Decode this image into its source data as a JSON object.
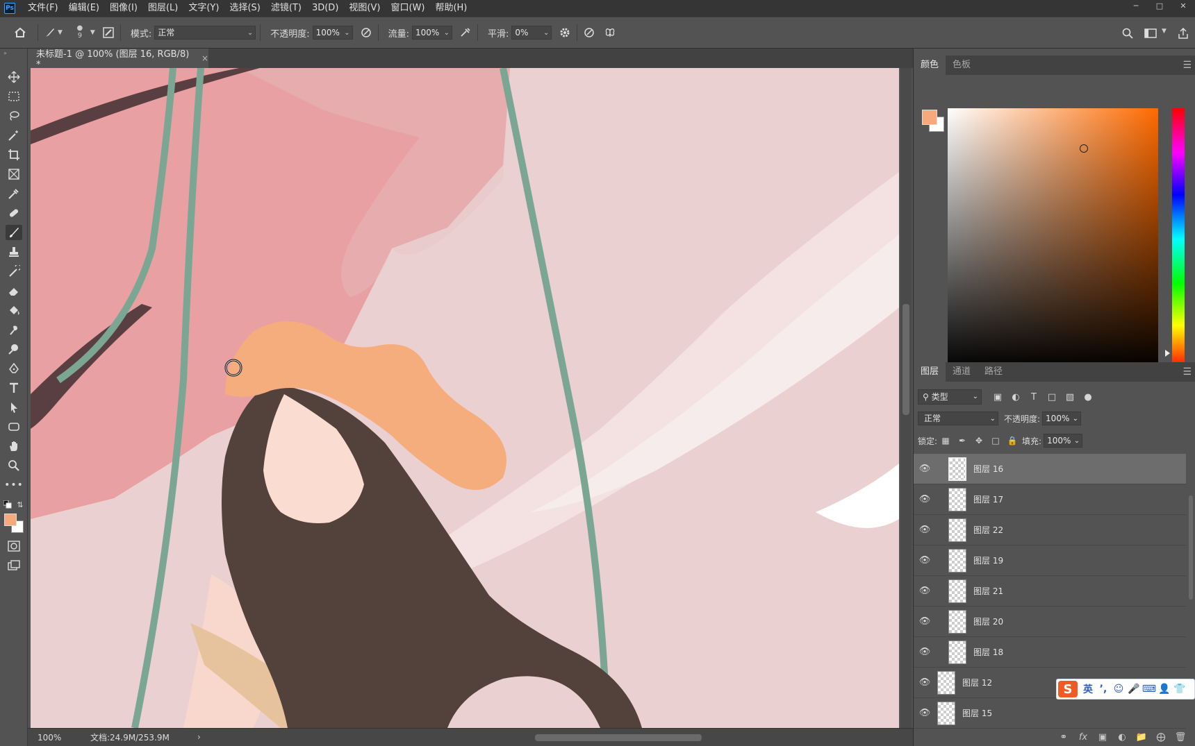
{
  "app": {
    "logo_text": "Ps"
  },
  "menu": [
    "文件(F)",
    "编辑(E)",
    "图像(I)",
    "图层(L)",
    "文字(Y)",
    "选择(S)",
    "滤镜(T)",
    "3D(D)",
    "视图(V)",
    "窗口(W)",
    "帮助(H)"
  ],
  "options": {
    "brush_size": "9",
    "mode_label": "模式:",
    "mode_value": "正常",
    "opacity_label": "不透明度:",
    "opacity_value": "100%",
    "flow_label": "流量:",
    "flow_value": "100%",
    "smooth_label": "平滑:",
    "smooth_value": "0%"
  },
  "document": {
    "tab_title": "未标题-1 @ 100% (图层 16, RGB/8) *",
    "close_glyph": "×"
  },
  "status": {
    "zoom": "100%",
    "doc_info": "文档:24.9M/253.9M",
    "arrow": "›"
  },
  "colors": {
    "foreground": "#f6a97a",
    "background": "#ffffff",
    "accent": "#31a8ff"
  },
  "color_panel": {
    "tabs": [
      "颜色",
      "色板"
    ]
  },
  "layers_panel": {
    "tabs": [
      "图层",
      "通道",
      "路径"
    ],
    "filter_kind": "类型",
    "blend_mode": "正常",
    "opacity_label": "不透明度:",
    "opacity_value": "100%",
    "lock_label": "锁定:",
    "fill_label": "填充:",
    "fill_value": "100%",
    "layers": [
      {
        "name": "图层 16",
        "selected": true
      },
      {
        "name": "图层 17"
      },
      {
        "name": "图层 22"
      },
      {
        "name": "图层 19"
      },
      {
        "name": "图层 21"
      },
      {
        "name": "图层 20"
      },
      {
        "name": "图层 18"
      },
      {
        "name": "图层 12"
      },
      {
        "name": "图层 15"
      }
    ]
  },
  "ime": {
    "logo": "S",
    "lang": "英"
  }
}
